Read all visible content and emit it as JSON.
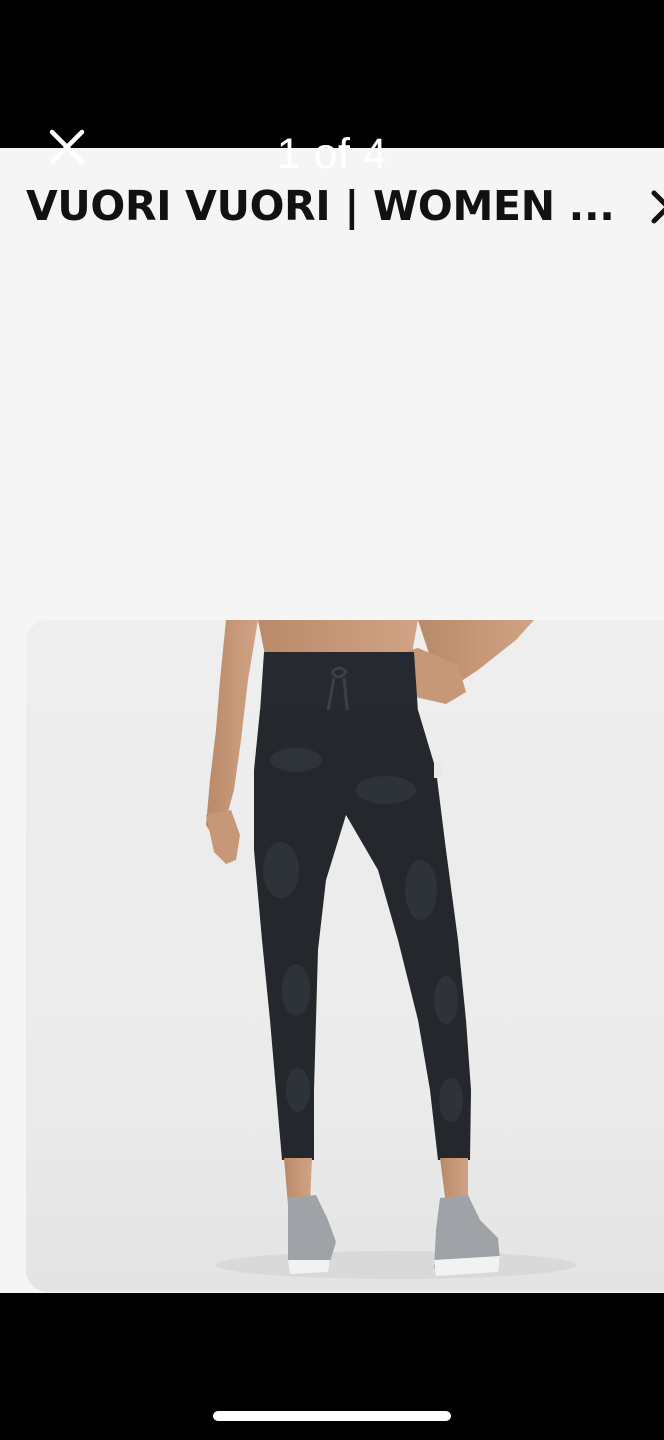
{
  "viewer": {
    "counter": "1 of 4",
    "title": "VUORI VUORI | WOMEN ..."
  },
  "icons": {
    "close": "close-icon",
    "next": "chevron-right-icon"
  },
  "colors": {
    "background": "#000000",
    "content_background": "#f5f5f5",
    "text": "#111111"
  }
}
